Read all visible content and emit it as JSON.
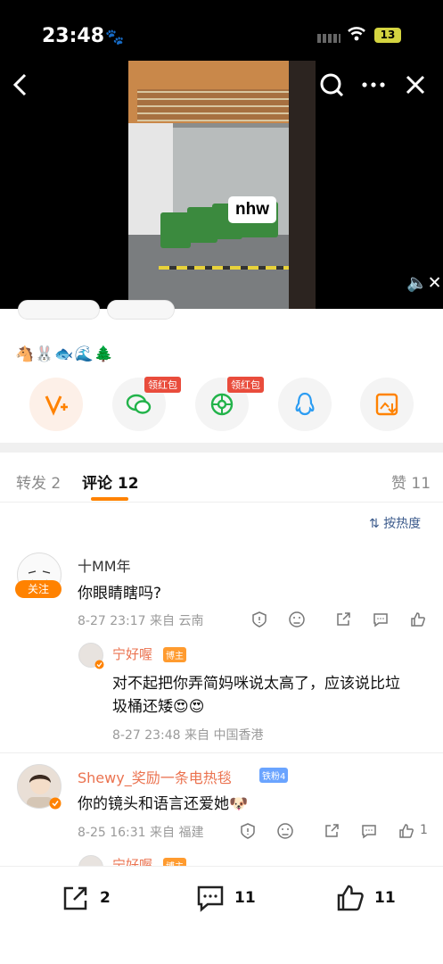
{
  "status": {
    "time": "23:48",
    "battery": "13"
  },
  "video": {
    "watermark": "nhw"
  },
  "emoji_row": "🐴🐰🐟🌊🌲",
  "share": {
    "wechat_badge": "领红包",
    "moments_badge": "领红包"
  },
  "tabs": {
    "reposts": "转发 2",
    "comments": "评论 12",
    "likes": "赞 11"
  },
  "sort_label": "按热度",
  "comments": [
    {
      "name": "十MM年",
      "follow": "关注",
      "text": "你眼睛瞎吗?",
      "meta": "8-27 23:17 来自 云南",
      "reply": {
        "name": "宁好喔",
        "badge": "博主",
        "line1": "对不起把你弄简妈咪说太高了，应该说比垃",
        "line2": "圾桶还矮😍😍",
        "meta": "8-27 23:48 来自 中国香港"
      }
    },
    {
      "name": "Shewy_奖励一条电热毯",
      "badge": "铁粉4",
      "text": "你的镜头和语言还爱她🐶",
      "meta": "8-25 16:31 来自 福建",
      "likes": "1",
      "reply": {
        "name": "宁好喔",
        "badge": "博主"
      }
    }
  ],
  "bottom": {
    "reposts": "2",
    "comments": "11",
    "likes": "11"
  },
  "colors": {
    "accent": "#ff8200",
    "link": "#3c5b8c",
    "name_orange": "#eb7350"
  }
}
